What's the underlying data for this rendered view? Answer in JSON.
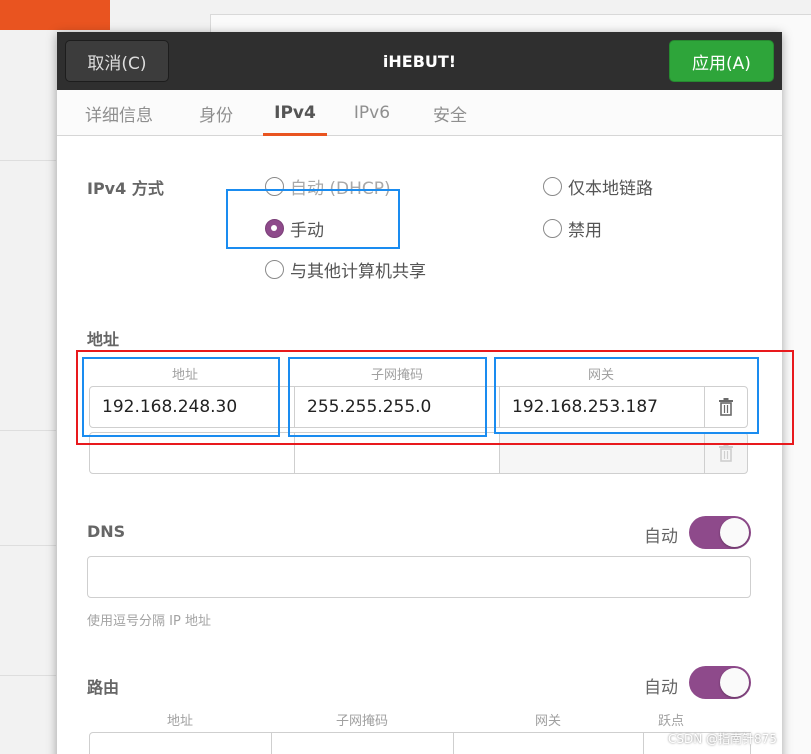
{
  "dialog": {
    "title": "iHEBUT!",
    "cancel_label": "取消(C)",
    "apply_label": "应用(A)"
  },
  "tabs": [
    {
      "label": "详细信息"
    },
    {
      "label": "身份"
    },
    {
      "label": "IPv4"
    },
    {
      "label": "IPv6"
    },
    {
      "label": "安全"
    }
  ],
  "ipv4_method": {
    "label": "IPv4 方式",
    "selected": "手动",
    "options": [
      {
        "label": "自动 (DHCP)"
      },
      {
        "label": "手动"
      },
      {
        "label": "与其他计算机共享"
      },
      {
        "label": "仅本地链路"
      },
      {
        "label": "禁用"
      }
    ]
  },
  "addresses": {
    "section_label": "地址",
    "columns": [
      "地址",
      "子网掩码",
      "网关"
    ],
    "rows": [
      {
        "address": "192.168.248.30",
        "netmask": "255.255.255.0",
        "gateway": "192.168.253.187"
      }
    ]
  },
  "dns": {
    "label": "DNS",
    "auto_label": "自动",
    "auto_enabled": true,
    "value": "",
    "hint": "使用逗号分隔 IP 地址"
  },
  "routes": {
    "label": "路由",
    "auto_label": "自动",
    "auto_enabled": true,
    "columns": [
      "地址",
      "子网掩码",
      "网关",
      "跃点"
    ]
  },
  "icons": {
    "delete": "trash-icon"
  },
  "colors": {
    "accent": "#8e4a8b",
    "apply_button": "#2ea53a",
    "tab_underline": "#e95420",
    "annotation_blue": "#1a8cf0",
    "annotation_red": "#e8191d"
  },
  "watermark": "CSDN @指南针875"
}
